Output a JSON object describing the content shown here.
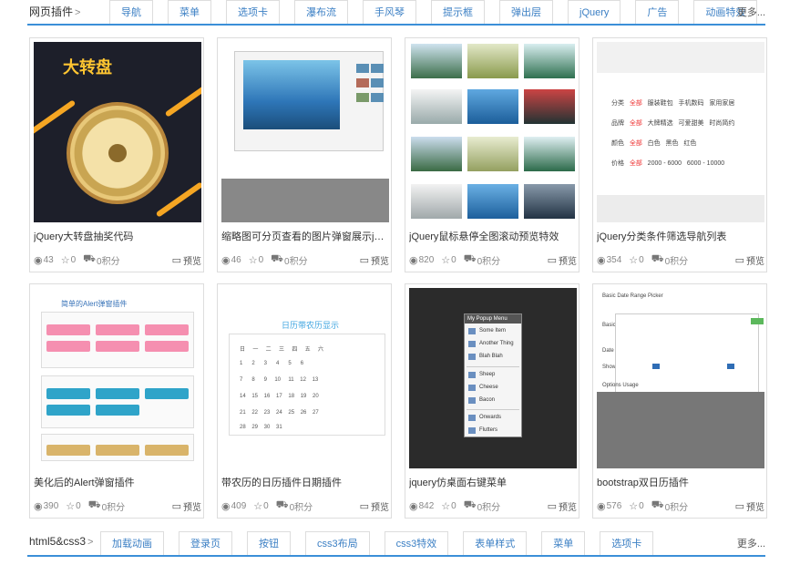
{
  "top_category": {
    "title": "网页插件",
    "tabs": [
      "导航",
      "菜单",
      "选项卡",
      "瀑布流",
      "手风琴",
      "提示框",
      "弹出层",
      "jQuery",
      "广告",
      "动画特效"
    ],
    "more": "更多..."
  },
  "cards": [
    {
      "title": "jQuery大转盘抽奖代码",
      "views": "43",
      "favs": "0",
      "points": "0积分",
      "preview": "预览",
      "thumb_text": "大转盘"
    },
    {
      "title": "缩略图可分页查看的图片弹窗展示jquery...",
      "views": "46",
      "favs": "0",
      "points": "0积分",
      "preview": "预览"
    },
    {
      "title": "jQuery鼠标悬停全图滚动预览特效",
      "views": "820",
      "favs": "0",
      "points": "0积分",
      "preview": "预览"
    },
    {
      "title": "jQuery分类条件筛选导航列表",
      "views": "354",
      "favs": "0",
      "points": "0积分",
      "preview": "预览"
    },
    {
      "title": "美化后的Alert弹窗插件",
      "views": "390",
      "favs": "0",
      "points": "0积分",
      "preview": "预览"
    },
    {
      "title": "带农历的日历插件日期插件",
      "views": "409",
      "favs": "0",
      "points": "0积分",
      "preview": "预览",
      "thumb_text": "日历带农历显示"
    },
    {
      "title": "jquery仿桌面右键菜单",
      "views": "842",
      "favs": "0",
      "points": "0积分",
      "preview": "预览",
      "menu": {
        "header": "My Popup Menu",
        "items": [
          "Some Item",
          "Another Thing",
          "Blah Blah",
          "Sheep",
          "Cheese",
          "Bacon",
          "Onwards",
          "Flutters"
        ]
      }
    },
    {
      "title": "bootstrap双日历插件",
      "views": "576",
      "favs": "0",
      "points": "0积分",
      "preview": "预览",
      "thumb_text": "Basic Date Range Picker"
    }
  ],
  "bottom_category": {
    "title": "html5&css3",
    "tabs": [
      "加载动画",
      "登录页",
      "按钮",
      "css3布局",
      "css3特效",
      "表单样式",
      "菜单",
      "选项卡"
    ],
    "more": "更多..."
  },
  "colors": {
    "accent": "#3b8fd8",
    "link": "#3b7fc4"
  },
  "icons": {
    "views": "eye-icon",
    "favs": "star-icon",
    "points": "cart-icon",
    "preview": "monitor-icon"
  }
}
